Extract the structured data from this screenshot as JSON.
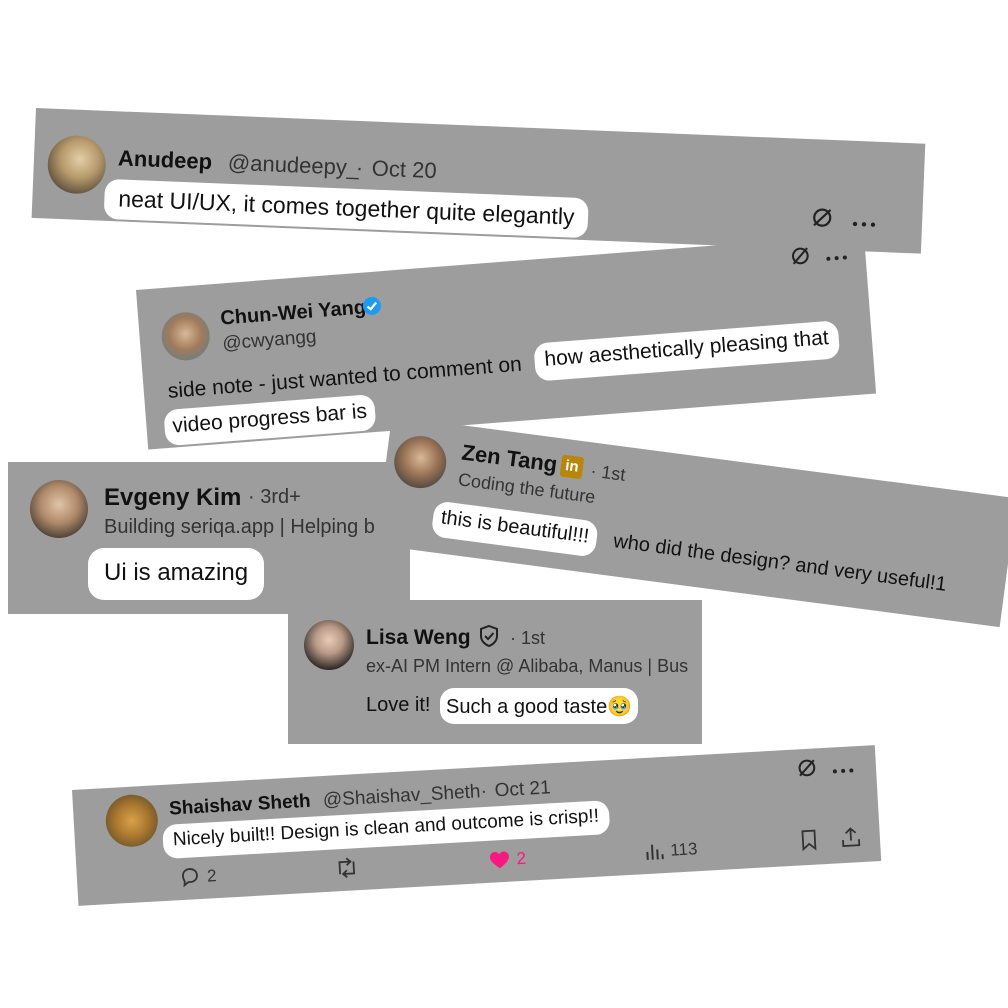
{
  "comments": [
    {
      "name": "Anudeep",
      "handle": "@anudeepy_",
      "sep": "·",
      "date": "Oct 20",
      "text_highlight": "neat UI/UX, it comes together quite elegantly"
    },
    {
      "name": "Chun-Wei Yang",
      "handle": "@cwyangg",
      "text_plain": "side note - just wanted to comment on",
      "text_highlight_1": "how aesthetically pleasing that",
      "text_highlight_2": "video progress bar is"
    },
    {
      "name": "Zen Tang",
      "linkedin_badge": "in",
      "degree": "· 1st",
      "headline": "Coding the future",
      "text_highlight": "this is beautiful!!!",
      "text_plain": "who did the design? and very useful!1"
    },
    {
      "name": "Evgeny Kim",
      "degree": "· 3rd+",
      "headline": "Building seriqa.app | Helping b",
      "text_highlight": "Ui is amazing"
    },
    {
      "name": "Lisa Weng",
      "degree": "· 1st",
      "headline": "ex-AI PM Intern @ Alibaba, Manus | Bus",
      "text_plain": "Love it!",
      "text_highlight": "Such a good taste🥹"
    },
    {
      "name": "Shaishav Sheth",
      "handle": "@Shaishav_Sheth",
      "sep": "·",
      "date": "Oct 21",
      "text_highlight": "Nicely built!! Design is clean and outcome is crisp!!",
      "replies": "2",
      "likes": "2",
      "views": "113"
    }
  ],
  "icons": [
    "grok-icon",
    "more-icon",
    "verified-badge-icon",
    "linkedin-icon",
    "shield-check-icon",
    "reply-icon",
    "retweet-icon",
    "heart-icon",
    "views-icon",
    "bookmark-icon",
    "share-icon"
  ],
  "colors": {
    "card_bg": "#9d9d9d",
    "highlight_bg": "#ffffff",
    "verified_blue": "#1d9bf0",
    "like_pink": "#f91880",
    "linkedin_gold": "#b8860b"
  }
}
